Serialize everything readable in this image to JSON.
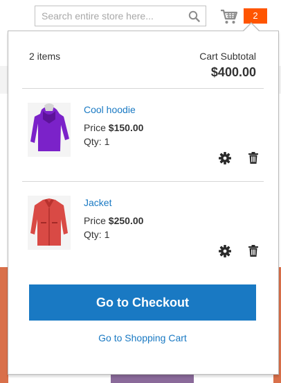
{
  "search": {
    "placeholder": "Search entire store here..."
  },
  "header": {
    "cart_count": "2"
  },
  "minicart": {
    "items_total": "2 items",
    "subtotal_label": "Cart Subtotal",
    "subtotal_amount": "$400.00",
    "price_label": "Price",
    "qty_label": "Qty:",
    "items": [
      {
        "name": "Cool hoodie",
        "price": "$150.00",
        "qty": "1",
        "color": "#7b22c9"
      },
      {
        "name": "Jacket",
        "price": "$250.00",
        "qty": "1",
        "color": "#d94a45"
      }
    ],
    "checkout_label": "Go to Checkout",
    "view_cart_label": "Go to Shopping Cart"
  },
  "colors": {
    "accent": "#1979c3",
    "counter": "#ff5501"
  }
}
